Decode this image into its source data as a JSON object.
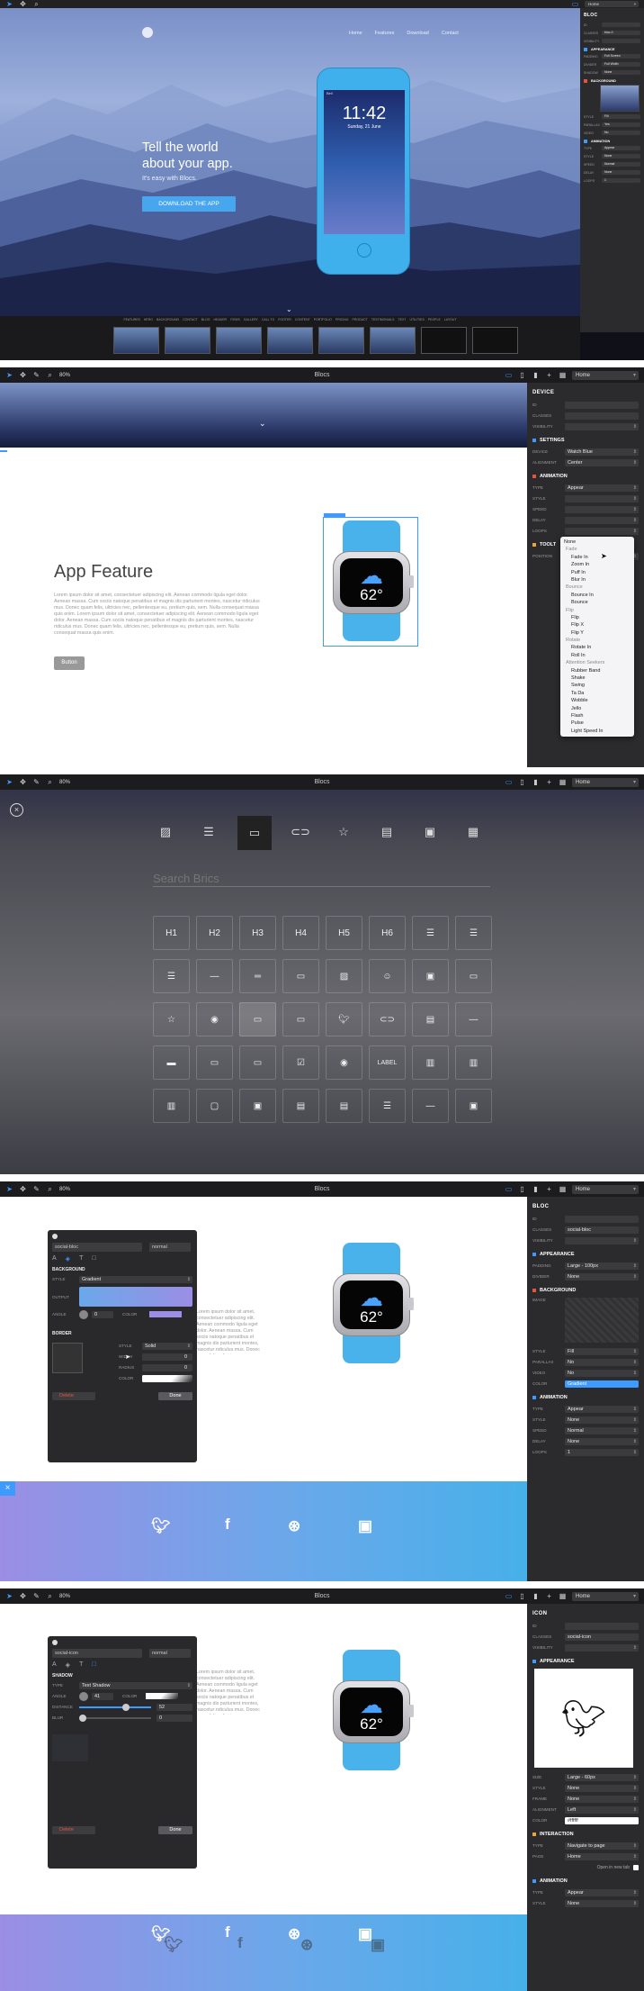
{
  "app": {
    "title": "Blocs",
    "zoom": "80%",
    "page_select": "Home"
  },
  "s1": {
    "nav": [
      "Home",
      "Features",
      "Download",
      "Contact"
    ],
    "headline": [
      "Tell the world",
      "about your app."
    ],
    "sub": "It's easy with Blocs.",
    "cta": "DOWNLOAD THE APP",
    "phone_time": "11:42",
    "phone_date": "Sunday, 21 June",
    "phone_status": "Bell",
    "page_select": "Home",
    "side_title": "BLOC",
    "side_rows": [
      {
        "label": "ID",
        "value": ""
      },
      {
        "label": "Classes",
        "value": "bloc-0"
      },
      {
        "label": "Visibility",
        "value": ""
      }
    ],
    "side_sec": "APPEARANCE",
    "side_rows2": [
      {
        "label": "Padding",
        "value": "Full Screen"
      },
      {
        "label": "Divider",
        "value": "Full Width"
      },
      {
        "label": "Shadow",
        "value": "None"
      }
    ],
    "side_sec2": "BACKGROUND",
    "side_rows3": [
      {
        "label": "Style",
        "value": "Fill"
      },
      {
        "label": "Parallax",
        "value": "Yes"
      },
      {
        "label": "Video",
        "value": "No"
      }
    ],
    "side_sec3": "ANIMATION",
    "side_rows4": [
      {
        "label": "Type",
        "value": "Appear"
      },
      {
        "label": "Style",
        "value": "None"
      },
      {
        "label": "Speed",
        "value": "Normal"
      },
      {
        "label": "Delay",
        "value": "None"
      },
      {
        "label": "Loops",
        "value": "1"
      }
    ],
    "strip_tabs": [
      "FEATURES",
      "HERO",
      "BACKGROUND",
      "CONTACT",
      "BLOG",
      "HEADER",
      "ITEMS",
      "GALLERY",
      "CALL TO",
      "FOOTER",
      "CONTENT",
      "PORTFOLIO",
      "PRICING",
      "PRODUCT",
      "TESTIMONIALS",
      "TEXT",
      "UTILITIES",
      "PEOPLE",
      "LAYOUT"
    ]
  },
  "s2": {
    "heading": "App Feature",
    "body": "Lorem ipsum dolor sit amet, consectetuer adipiscing elit. Aenean commodo ligula eget dolor. Aenean massa. Cum sociis natoque penatibus et magnis dis parturient montes, nascetur ridiculus mus. Donec quam felis, ultricies nec, pellentesque eu, pretium quis, sem. Nulla consequat massa quis enim. Lorem ipsum dolor sit amet, consectetuer adipiscing elit. Aenean commodo ligula eget dolor. Aenean massa. Cum sociis natoque penatibus et magnis dis parturient montes, nascetur ridiculus mus. Donec quam felis, ultricies nec, pellentesque eu, pretium quis, sem. Nulla consequat massa quis enim.",
    "button": "Button",
    "watch_temp": "62°",
    "side_title": "DEVICE",
    "rows": [
      {
        "label": "ID",
        "value": ""
      },
      {
        "label": "Classes",
        "value": ""
      },
      {
        "label": "Visibility",
        "value": ""
      }
    ],
    "sec_settings": "SETTINGS",
    "settings": [
      {
        "label": "Device",
        "value": "Watch Blue"
      },
      {
        "label": "Alignment",
        "value": "Center"
      }
    ],
    "sec_anim": "ANIMATION",
    "anim": [
      {
        "label": "Type",
        "value": "Appear"
      },
      {
        "label": "Style",
        "value": ""
      },
      {
        "label": "Speed",
        "value": ""
      },
      {
        "label": "Delay",
        "value": ""
      },
      {
        "label": "Loops",
        "value": ""
      }
    ],
    "sec_tooltip": "TOOLT",
    "tooltip_label": "POSITION",
    "menu": [
      {
        "t": "None",
        "k": "chk"
      },
      {
        "t": "Fade",
        "k": "g"
      },
      {
        "t": "Fade In",
        "k": ""
      },
      {
        "t": "Zoom In",
        "k": ""
      },
      {
        "t": "Puff In",
        "k": ""
      },
      {
        "t": "Blur In",
        "k": ""
      },
      {
        "t": "Bounce",
        "k": "g"
      },
      {
        "t": "Bounce In",
        "k": ""
      },
      {
        "t": "Bounce",
        "k": ""
      },
      {
        "t": "Flip",
        "k": "g"
      },
      {
        "t": "Flip",
        "k": ""
      },
      {
        "t": "Flip X",
        "k": ""
      },
      {
        "t": "Flip Y",
        "k": ""
      },
      {
        "t": "Rotate",
        "k": "g"
      },
      {
        "t": "Rotate In",
        "k": ""
      },
      {
        "t": "Roll In",
        "k": ""
      },
      {
        "t": "Attention Seekers",
        "k": "g"
      },
      {
        "t": "Rubber Band",
        "k": ""
      },
      {
        "t": "Shake",
        "k": ""
      },
      {
        "t": "Swing",
        "k": ""
      },
      {
        "t": "Ta Da",
        "k": ""
      },
      {
        "t": "Wobble",
        "k": ""
      },
      {
        "t": "Jello",
        "k": ""
      },
      {
        "t": "Flash",
        "k": ""
      },
      {
        "t": "Pulse",
        "k": ""
      },
      {
        "t": "Light Speed In",
        "k": ""
      }
    ]
  },
  "s3": {
    "search_placeholder": "Search Brics",
    "row1": [
      "H1",
      "H2",
      "H3",
      "H4",
      "H5",
      "H6"
    ],
    "label_text": "LABEL"
  },
  "s4": {
    "class_value": "social-bloc",
    "state": "normal",
    "sec_bg": "BACKGROUND",
    "style_label": "STYLE",
    "style_value": "Gradient",
    "output_label": "OUTPUT",
    "angle_label": "ANGLE",
    "angle_value": "0",
    "color_label": "COLOR",
    "sec_border": "BORDER",
    "b_style_label": "STYLE",
    "b_style_value": "Solid",
    "b_width_label": "WIDTH",
    "b_width_value": "0",
    "b_radius_label": "RADIUS",
    "b_radius_value": "0",
    "b_color_label": "COLOR",
    "delete": "Delete",
    "done": "Done",
    "watch_temp": "62°",
    "side_title": "BLOC",
    "rows": [
      {
        "label": "ID",
        "value": ""
      },
      {
        "label": "Classes",
        "value": "social-bloc"
      },
      {
        "label": "Visibility",
        "value": ""
      }
    ],
    "sec_app": "APPEARANCE",
    "app_rows": [
      {
        "label": "Padding",
        "value": "Large - 100px"
      },
      {
        "label": "Divider",
        "value": "None"
      }
    ],
    "sec_bg2": "BACKGROUND",
    "image_label": "IMAGE",
    "bg_rows": [
      {
        "label": "Style",
        "value": "Fill"
      },
      {
        "label": "Parallax",
        "value": "No"
      },
      {
        "label": "Video",
        "value": "No"
      },
      {
        "label": "Color",
        "value": "Gradient"
      }
    ],
    "sec_anim": "ANIMATION",
    "anim_rows": [
      {
        "label": "Type",
        "value": "Appear"
      },
      {
        "label": "Style",
        "value": "None"
      },
      {
        "label": "Speed",
        "value": "Normal"
      },
      {
        "label": "Delay",
        "value": "None"
      },
      {
        "label": "Loops",
        "value": "1"
      }
    ]
  },
  "s5": {
    "class_value": "social-icon",
    "state": "normal",
    "sec_shadow": "SHADOW",
    "type_label": "TYPE",
    "type_value": "Text Shadow",
    "angle_label": "ANGLE",
    "angle_value": "41",
    "color_label": "COLOR",
    "distance_label": "DISTANCE",
    "distance_value": "52",
    "blur_label": "BLUR",
    "blur_value": "0",
    "delete": "Delete",
    "done": "Done",
    "watch_temp": "62°",
    "side_title": "ICON",
    "rows": [
      {
        "label": "ID",
        "value": ""
      },
      {
        "label": "Classes",
        "value": "social-icon"
      },
      {
        "label": "Visibility",
        "value": ""
      }
    ],
    "sec_app": "APPEARANCE",
    "app_rows": [
      {
        "label": "Size",
        "value": "Large - 60px"
      },
      {
        "label": "Style",
        "value": "None"
      },
      {
        "label": "Frame",
        "value": "None"
      },
      {
        "label": "Alignment",
        "value": "Left"
      },
      {
        "label": "Color",
        "value": "#ffffff"
      }
    ],
    "sec_inter": "INTERACTION",
    "inter_rows": [
      {
        "label": "Type",
        "value": "Navigate to page"
      },
      {
        "label": "Page",
        "value": "Home"
      }
    ],
    "new_tab": "Open in new tab",
    "sec_anim": "ANIMATION",
    "anim_rows": [
      {
        "label": "Type",
        "value": "Appear"
      },
      {
        "label": "Style",
        "value": "None"
      }
    ]
  }
}
